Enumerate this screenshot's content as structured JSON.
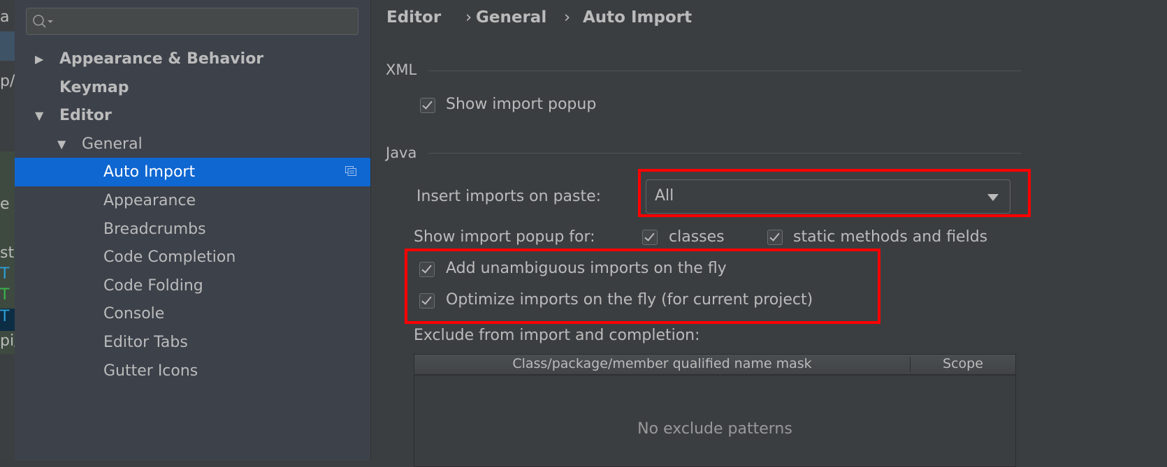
{
  "left_strip": {
    "fragments": [
      "a",
      "p/",
      "e",
      "st",
      "T",
      "T",
      "T",
      "pi/"
    ]
  },
  "sidebar": {
    "search": {
      "placeholder": "",
      "value": ""
    },
    "items": [
      {
        "label": "Appearance & Behavior",
        "level": 0,
        "expanded": false,
        "has_arrow": true
      },
      {
        "label": "Keymap",
        "level": 0,
        "has_arrow": false
      },
      {
        "label": "Editor",
        "level": 0,
        "expanded": true,
        "has_arrow": true
      },
      {
        "label": "General",
        "level": 1,
        "expanded": true,
        "has_arrow": true
      },
      {
        "label": "Auto Import",
        "level": 2,
        "selected": true
      },
      {
        "label": "Appearance",
        "level": 2
      },
      {
        "label": "Breadcrumbs",
        "level": 2
      },
      {
        "label": "Code Completion",
        "level": 2
      },
      {
        "label": "Code Folding",
        "level": 2
      },
      {
        "label": "Console",
        "level": 2
      },
      {
        "label": "Editor Tabs",
        "level": 2
      },
      {
        "label": "Gutter Icons",
        "level": 2
      }
    ]
  },
  "breadcrumb": {
    "items": [
      "Editor",
      "General",
      "Auto Import"
    ],
    "separator": "›"
  },
  "xml": {
    "section_label": "XML",
    "show_import_popup": {
      "label": "Show import popup",
      "checked": true
    }
  },
  "java": {
    "section_label": "Java",
    "insert_imports_label": "Insert imports on paste:",
    "insert_imports_value": "All",
    "show_popup_for_label": "Show import popup for:",
    "classes": {
      "label": "classes",
      "checked": true
    },
    "static": {
      "label": "static methods and fields",
      "checked": true
    },
    "add_unambiguous": {
      "label": "Add unambiguous imports on the fly",
      "checked": true
    },
    "optimize": {
      "label": "Optimize imports on the fly (for current project)",
      "checked": true
    },
    "exclude_label": "Exclude from import and completion:",
    "table": {
      "columns": [
        "Class/package/member qualified name mask",
        "Scope"
      ],
      "empty_text": "No exclude patterns"
    }
  },
  "colors": {
    "selection": "#0f67d2",
    "highlight_box": "#ff0000",
    "sidebar_bg": "#3c414a",
    "panel_bg": "#3b3e41"
  }
}
